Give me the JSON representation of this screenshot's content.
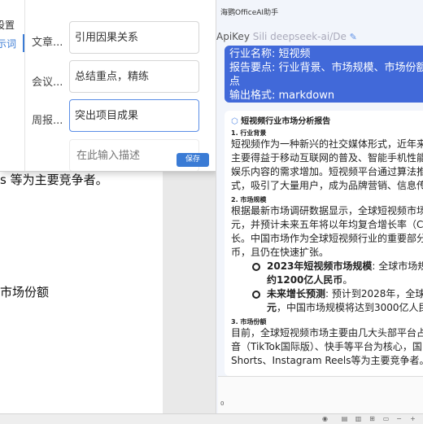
{
  "document": {
    "line1": "s 等为主要竞争者。",
    "line2": "市场份额"
  },
  "settings_popup": {
    "sidebar_items": [
      {
        "label": "设置"
      },
      {
        "label": "示词"
      }
    ],
    "fields": [
      {
        "label": "文章...",
        "value": "引用因果关系"
      },
      {
        "label": "会议...",
        "value": "总结重点，精练"
      },
      {
        "label": "周报...",
        "value": "突出项目成果"
      },
      {
        "label": "",
        "placeholder": "在此输入描述"
      }
    ],
    "save_label": "保存"
  },
  "assistant": {
    "title": "海鹦OfficeAI助手",
    "apikey_label": "ApiKey",
    "apikey_value": "Sili deepseek-ai/De",
    "user_message": {
      "line1": "行业名称: 短视频",
      "line2": "报告要点: 行业背景、市场规模、市场份额、竞",
      "line3": "点",
      "line4": "输出格式: markdown"
    },
    "reply": {
      "title": "短视频行业市场分析报告",
      "sections": [
        {
          "heading": "1. 行业背景",
          "lines": [
            "短视频作为一种新兴的社交媒体形式，近年来",
            "主要得益于移动互联网的普及、智能手机性能",
            "娱乐内容的需求增加。短视频平台通过算法推",
            "式，吸引了大量用户，成为品牌营销、信息传"
          ]
        },
        {
          "heading": "2. 市场规模",
          "lines": [
            "根据最新市场调研数据显示，全球短视频市场",
            "元，并预计未来五年将以年均复合增长率（C",
            "长。中国市场作为全球短视频行业的重要部分",
            "币，且仍在快速扩张。"
          ],
          "bullets": [
            {
              "bold": "2023年短视频市场规模",
              "rest": ": 全球市场规",
              "line2_bold": "约1200亿人民币",
              "line2_rest": "。"
            },
            {
              "bold": "未来增长预测",
              "rest": ": 预计到2028年，全球",
              "line2_bold": "元",
              "line2_rest": "，中国市场规模将达到3000亿人民"
            }
          ]
        },
        {
          "heading": "3. 市场份额",
          "lines": [
            "目前，全球短视频市场主要由几大头部平台占",
            "音（TikTok国际版）、快手等平台为核心，国",
            "Shorts、Instagram Reels等为主要竞争者。"
          ]
        }
      ]
    },
    "input_count": "0"
  }
}
